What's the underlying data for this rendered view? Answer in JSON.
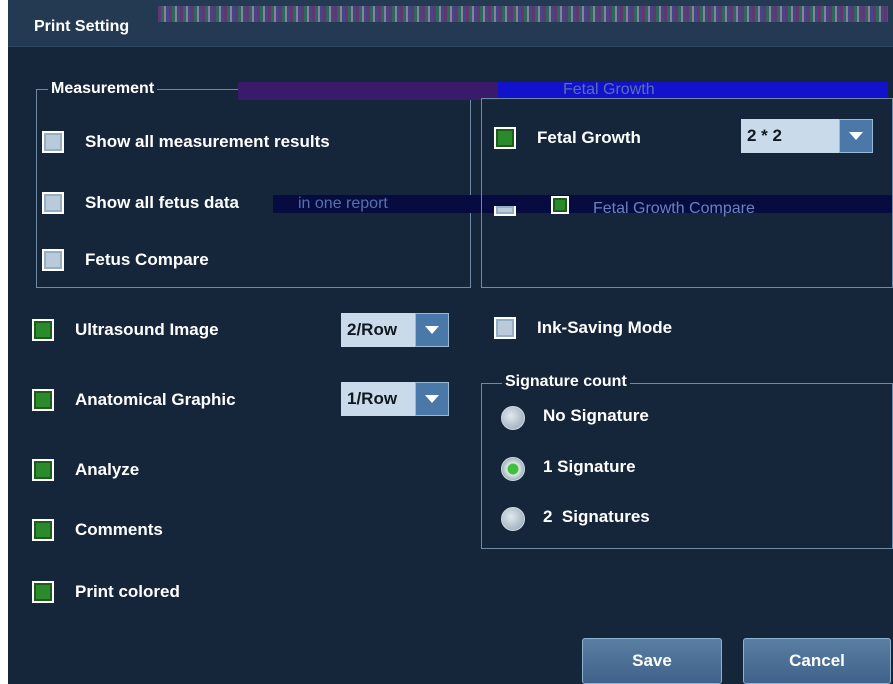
{
  "window": {
    "title": "Print Setting"
  },
  "measurement": {
    "title": "Measurement",
    "items": [
      {
        "label": "Show all measurement results",
        "checked": false
      },
      {
        "label": "Show all fetus data",
        "checked": false
      },
      {
        "label": "Fetus Compare",
        "checked": false
      }
    ],
    "overlay_text_1": "in one report",
    "overlay_text_2": "Fetal Growth"
  },
  "fetal": {
    "growth_label": "Fetal Growth",
    "growth_checked": true,
    "layout_value": "2 * 2",
    "compare_label": "Fetal Growth Compare"
  },
  "options": [
    {
      "label": "Ultrasound Image",
      "checked": true,
      "combo": "2/Row"
    },
    {
      "label": "Anatomical Graphic",
      "checked": true,
      "combo": "1/Row"
    },
    {
      "label": "Analyze",
      "checked": true
    },
    {
      "label": "Comments",
      "checked": true
    },
    {
      "label": "Print colored",
      "checked": true
    }
  ],
  "ink_saving": {
    "label": "Ink-Saving Mode",
    "checked": false
  },
  "signature": {
    "title": "Signature count",
    "options": [
      {
        "label": "No Signature",
        "selected": false
      },
      {
        "label": "1 Signature",
        "selected": true
      },
      {
        "label": "2  Signatures",
        "selected": false
      }
    ]
  },
  "buttons": {
    "save": "Save",
    "cancel": "Cancel"
  },
  "colors": {
    "background": "#16263a",
    "checked": "#2b8a2b",
    "button": "#4a6f96"
  },
  "icons": {
    "combo_arrow": "chevron-down-icon"
  }
}
